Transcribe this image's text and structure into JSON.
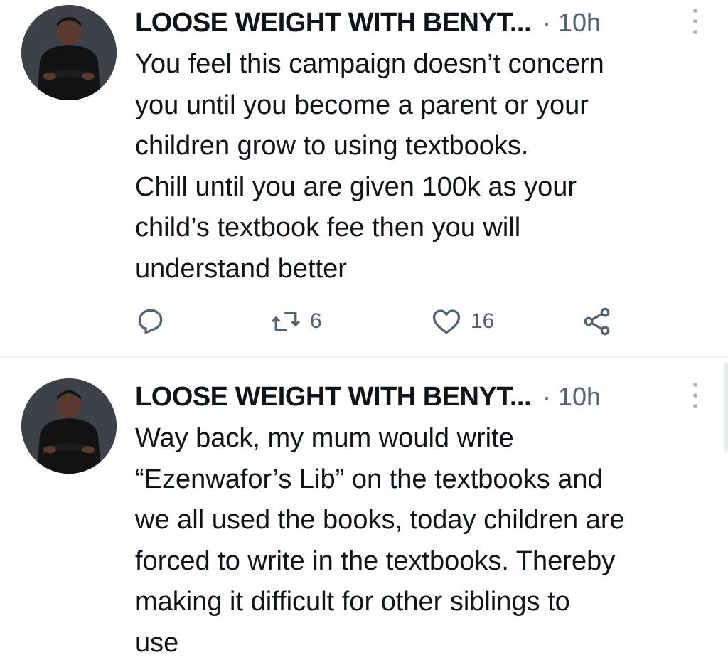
{
  "tweets": [
    {
      "author": "LOOSE WEIGHT WITH BENYT...",
      "separator": "·",
      "time": "10h",
      "text": "You feel this campaign doesn’t concern\nyou until you become a parent or your\nchildren grow to using textbooks.\nChill until you are given 100k as your\nchild’s textbook fee then you will\nunderstand better",
      "retweets": "6",
      "likes": "16"
    },
    {
      "author": "LOOSE WEIGHT WITH BENYT...",
      "separator": "·",
      "time": "10h",
      "text": "Way back, my mum would write\n“Ezenwafor’s Lib” on the textbooks and\nwe all used the books, today children are\nforced to write in the textbooks. Thereby\nmaking it difficult for other siblings to\nuse"
    }
  ],
  "icons": {
    "reply": "reply-icon",
    "retweet": "retweet-icon",
    "like": "heart-icon",
    "share": "share-icon",
    "more": "more-vertical-icon"
  },
  "colors": {
    "text": "#0f1419",
    "secondary": "#536471",
    "divider": "#eff3f4"
  }
}
